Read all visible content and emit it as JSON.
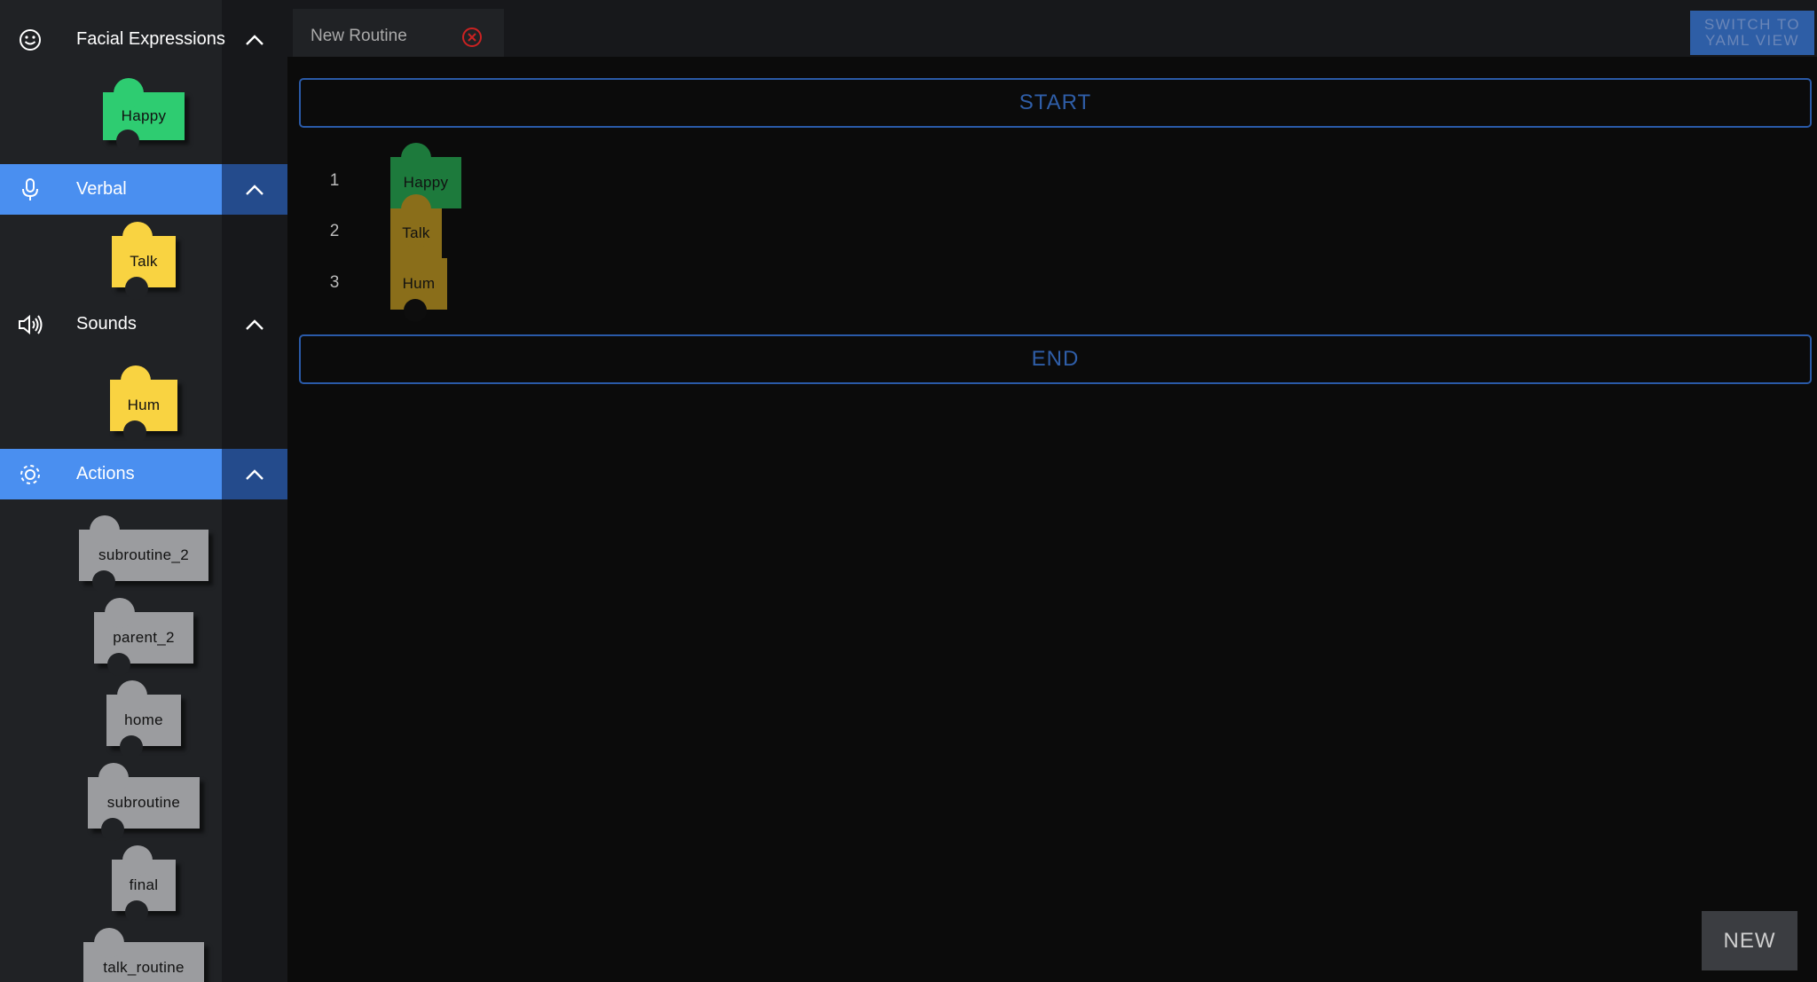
{
  "sidebar": {
    "categories": [
      {
        "label": "Facial Expressions",
        "icon": "smiley-icon",
        "selected": false,
        "blocks": [
          {
            "label": "Happy",
            "color": "#2ecc71"
          }
        ]
      },
      {
        "label": "Verbal",
        "icon": "microphone-icon",
        "selected": true,
        "blocks": [
          {
            "label": "Talk",
            "color": "#f9d341"
          }
        ]
      },
      {
        "label": "Sounds",
        "icon": "speaker-icon",
        "selected": false,
        "blocks": [
          {
            "label": "Hum",
            "color": "#f9d341"
          }
        ]
      },
      {
        "label": "Actions",
        "icon": "gear-icon",
        "selected": true,
        "blocks": [
          {
            "label": "subroutine_2",
            "color": "#9b9c9f"
          },
          {
            "label": "parent_2",
            "color": "#9b9c9f"
          },
          {
            "label": "home",
            "color": "#9b9c9f"
          },
          {
            "label": "subroutine",
            "color": "#9b9c9f"
          },
          {
            "label": "final",
            "color": "#9b9c9f"
          },
          {
            "label": "talk_routine",
            "color": "#9b9c9f"
          }
        ]
      }
    ]
  },
  "tab": {
    "title": "New Routine"
  },
  "toolbar": {
    "yaml_line1": "SWITCH TO",
    "yaml_line2": "YAML VIEW"
  },
  "routine": {
    "start_label": "START",
    "end_label": "END",
    "steps": [
      {
        "number": "1",
        "label": "Happy",
        "color": "#1d7a3c"
      },
      {
        "number": "2",
        "label": "Talk",
        "color": "#8a6e1a"
      },
      {
        "number": "3",
        "label": "Hum",
        "color": "#8a6e1a"
      }
    ]
  },
  "new_button": {
    "label": "NEW"
  },
  "colors": {
    "accent": "#4a8ff0",
    "outline": "#2a5aa8"
  }
}
